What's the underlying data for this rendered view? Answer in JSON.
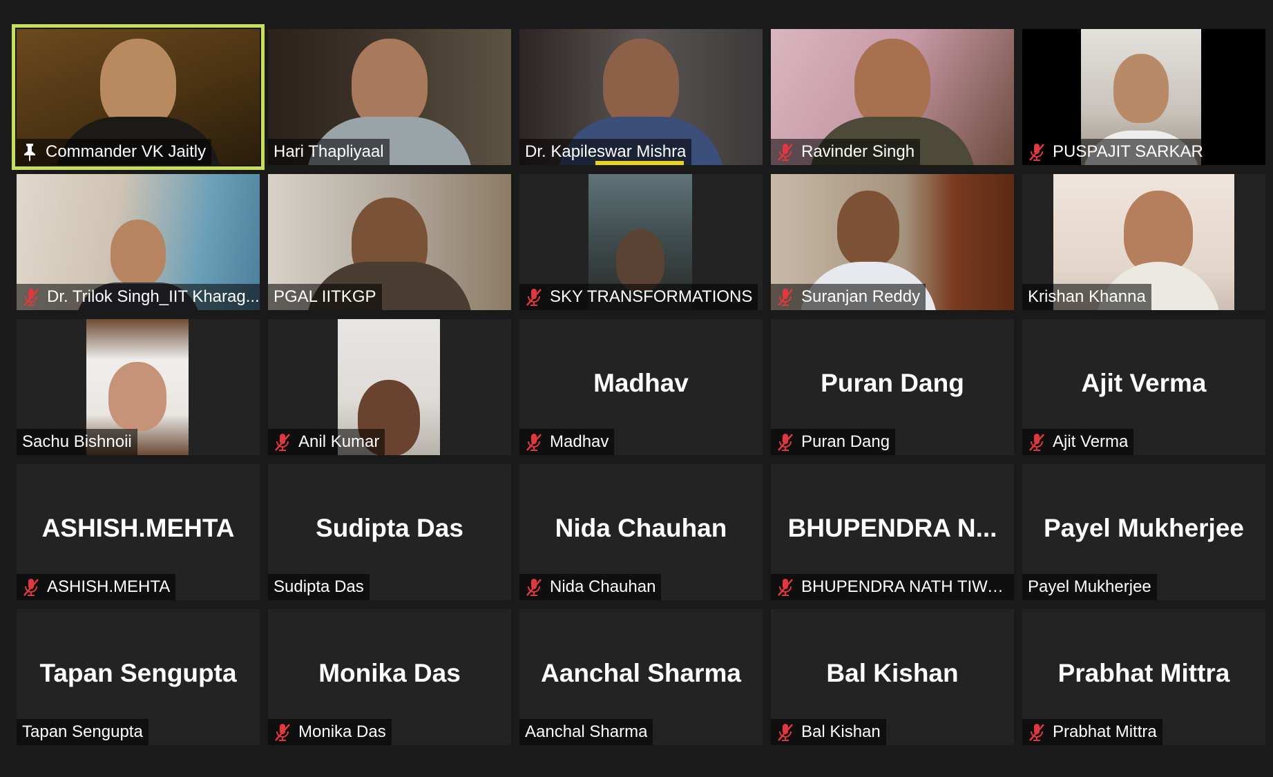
{
  "accent_color": "#c7df5a",
  "muted_icon_color": "#e0383e",
  "participants": [
    {
      "name": "Commander VK Jaitly",
      "display_name": "",
      "muted": false,
      "pinned": true,
      "active": true,
      "video": true
    },
    {
      "name": "Hari Thapliyaal",
      "display_name": "",
      "muted": false,
      "pinned": false,
      "active": false,
      "video": true
    },
    {
      "name": "Dr. Kapileswar Mishra",
      "display_name": "",
      "muted": false,
      "pinned": false,
      "active": false,
      "video": true,
      "speaking": true
    },
    {
      "name": "Ravinder Singh",
      "display_name": "",
      "muted": true,
      "pinned": false,
      "active": false,
      "video": true
    },
    {
      "name": "PUSPAJIT SARKAR",
      "display_name": "",
      "muted": true,
      "pinned": false,
      "active": false,
      "video": true
    },
    {
      "name": "Dr. Trilok Singh_IIT Kharag...",
      "display_name": "",
      "muted": true,
      "pinned": false,
      "active": false,
      "video": true
    },
    {
      "name": "PGAL IITKGP",
      "display_name": "",
      "muted": false,
      "pinned": false,
      "active": false,
      "video": true
    },
    {
      "name": "SKY TRANSFORMATIONS",
      "display_name": "",
      "muted": true,
      "pinned": false,
      "active": false,
      "video": true
    },
    {
      "name": "Suranjan Reddy",
      "display_name": "",
      "muted": true,
      "pinned": false,
      "active": false,
      "video": true
    },
    {
      "name": "Krishan Khanna",
      "display_name": "",
      "muted": false,
      "pinned": false,
      "active": false,
      "video": true
    },
    {
      "name": "Sachu Bishnoii",
      "display_name": "",
      "muted": false,
      "pinned": false,
      "active": false,
      "video": true
    },
    {
      "name": "Anil Kumar",
      "display_name": "",
      "muted": true,
      "pinned": false,
      "active": false,
      "video": true
    },
    {
      "name": "Madhav",
      "display_name": "Madhav",
      "muted": true,
      "pinned": false,
      "active": false,
      "video": false
    },
    {
      "name": "Puran Dang",
      "display_name": "Puran Dang",
      "muted": true,
      "pinned": false,
      "active": false,
      "video": false
    },
    {
      "name": "Ajit Verma",
      "display_name": "Ajit Verma",
      "muted": true,
      "pinned": false,
      "active": false,
      "video": false
    },
    {
      "name": "ASHISH.MEHTA",
      "display_name": "ASHISH.MEHTA",
      "muted": true,
      "pinned": false,
      "active": false,
      "video": false
    },
    {
      "name": "Sudipta Das",
      "display_name": "Sudipta Das",
      "muted": false,
      "pinned": false,
      "active": false,
      "video": false
    },
    {
      "name": "Nida Chauhan",
      "display_name": "Nida Chauhan",
      "muted": true,
      "pinned": false,
      "active": false,
      "video": false
    },
    {
      "name": "BHUPENDRA NATH TIWARY",
      "display_name": "BHUPENDRA  N...",
      "muted": true,
      "pinned": false,
      "active": false,
      "video": false
    },
    {
      "name": "Payel Mukherjee",
      "display_name": "Payel Mukherjee",
      "muted": false,
      "pinned": false,
      "active": false,
      "video": false
    },
    {
      "name": "Tapan Sengupta",
      "display_name": "Tapan Sengupta",
      "muted": false,
      "pinned": false,
      "active": false,
      "video": false
    },
    {
      "name": "Monika Das",
      "display_name": "Monika Das",
      "muted": true,
      "pinned": false,
      "active": false,
      "video": false
    },
    {
      "name": "Aanchal Sharma",
      "display_name": "Aanchal Sharma",
      "muted": false,
      "pinned": false,
      "active": false,
      "video": false
    },
    {
      "name": "Bal Kishan",
      "display_name": "Bal Kishan",
      "muted": true,
      "pinned": false,
      "active": false,
      "video": false
    },
    {
      "name": "Prabhat Mittra",
      "display_name": "Prabhat Mittra",
      "muted": true,
      "pinned": false,
      "active": false,
      "video": false
    }
  ]
}
